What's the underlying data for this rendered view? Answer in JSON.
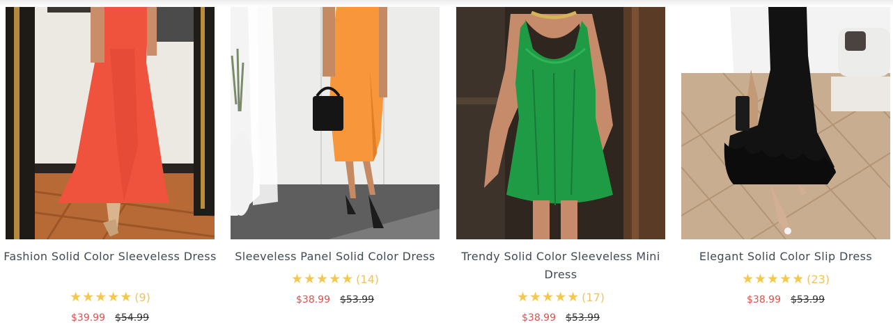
{
  "products": [
    {
      "title": "Fashion Solid Color Sleeveless Dress",
      "stars": "★★★★★",
      "rating_value": 5,
      "review_count": "(9)",
      "sale_price": "$39.99",
      "original_price": "$54.99",
      "dress_color": "#f0533d",
      "image_icon": "red-maxi-dress-photo"
    },
    {
      "title": "Sleeveless Panel Solid Color Dress",
      "stars": "★★★★★",
      "rating_value": 5,
      "review_count": "(14)",
      "sale_price": "$38.99",
      "original_price": "$53.99",
      "dress_color": "#f7963a",
      "image_icon": "orange-slit-dress-photo"
    },
    {
      "title": "Trendy Solid Color Sleeveless Mini Dress",
      "stars": "★★★★★",
      "rating_value": 5,
      "review_count": "(17)",
      "sale_price": "$38.99",
      "original_price": "$53.99",
      "dress_color": "#1f9a45",
      "image_icon": "green-mini-dress-photo"
    },
    {
      "title": "Elegant Solid Color Slip Dress",
      "stars": "★★★★★",
      "rating_value": 5,
      "review_count": "(23)",
      "sale_price": "$38.99",
      "original_price": "$53.99",
      "dress_color": "#121212",
      "image_icon": "black-ruffle-dress-photo"
    }
  ],
  "colors": {
    "star": "#f5c84c",
    "sale_price": "#d9534f",
    "title_text": "#3f4a55"
  }
}
